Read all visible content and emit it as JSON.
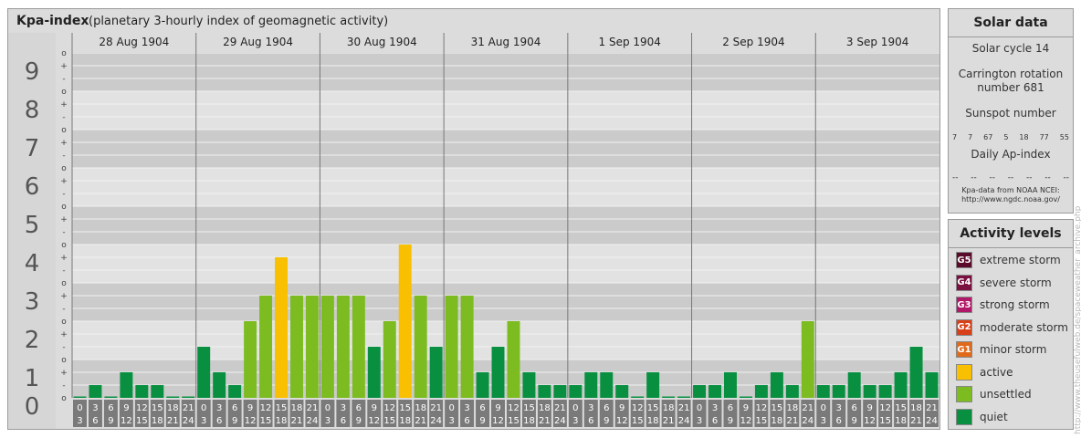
{
  "header": {
    "title": "Kpa-index",
    "subtitle": "(planetary 3-hourly index of geomagnetic activity)"
  },
  "solar": {
    "heading": "Solar data",
    "cycle": "Solar cycle 14",
    "carrington_line1": "Carrington rotation",
    "carrington_line2": "number 681",
    "sunspot_label": "Sunspot number",
    "sunspots": [
      "7",
      "7",
      "67",
      "5",
      "18",
      "77",
      "55"
    ],
    "ap_label": "Daily Ap-index",
    "ap_values": [
      "--",
      "--",
      "--",
      "--",
      "--",
      "--",
      "--"
    ],
    "source_line1": "Kpa-data from NOAA NCEI:",
    "source_line2": "http://www.ngdc.noaa.gov/"
  },
  "levels": {
    "heading": "Activity levels",
    "items": [
      {
        "code": "G5",
        "label": "extreme storm",
        "color": "#5a0a2a"
      },
      {
        "code": "G4",
        "label": "severe storm",
        "color": "#7a1040"
      },
      {
        "code": "G3",
        "label": "strong storm",
        "color": "#b01868"
      },
      {
        "code": "G2",
        "label": "moderate storm",
        "color": "#d8401a"
      },
      {
        "code": "G1",
        "label": "minor storm",
        "color": "#e06a1a"
      },
      {
        "code": "",
        "label": "active",
        "color": "#f8c000"
      },
      {
        "code": "",
        "label": "unsettled",
        "color": "#7cbc20"
      },
      {
        "code": "",
        "label": "quiet",
        "color": "#089040"
      }
    ]
  },
  "credit": "http://www.theusefulweb.de/spaceweather_archive.php",
  "chart_data": {
    "type": "bar",
    "ylim": [
      0,
      9
    ],
    "y_ticks": [
      "0",
      "1",
      "2",
      "3",
      "4",
      "5",
      "6",
      "7",
      "8",
      "9"
    ],
    "sub_ticks": [
      "o",
      "-",
      "+",
      "o",
      "-",
      "+",
      "o",
      "-",
      "+",
      "o",
      "-",
      "+",
      "o",
      "-",
      "+",
      "o",
      "-",
      "+",
      "o",
      "-",
      "+",
      "o",
      "-",
      "+",
      "o",
      "-",
      "+",
      "o"
    ],
    "days": [
      "28 Aug 1904",
      "29 Aug 1904",
      "30 Aug 1904",
      "31 Aug 1904",
      "1 Sep 1904",
      "2 Sep 1904",
      "3 Sep 1904"
    ],
    "interval_labels": [
      [
        "0",
        "3"
      ],
      [
        "3",
        "6"
      ],
      [
        "6",
        "9"
      ],
      [
        "9",
        "12"
      ],
      [
        "12",
        "15"
      ],
      [
        "15",
        "18"
      ],
      [
        "18",
        "21"
      ],
      [
        "21",
        "24"
      ]
    ],
    "values": [
      0,
      0.333,
      0,
      0.667,
      0.333,
      0.333,
      0,
      0,
      1.333,
      0.667,
      0.333,
      2,
      2.667,
      3.667,
      2.667,
      2.667,
      2.667,
      2.667,
      2.667,
      1.333,
      2,
      4,
      2.667,
      1.333,
      2.667,
      2.667,
      0.667,
      1.333,
      2,
      0.667,
      0.333,
      0.333,
      0.333,
      0.667,
      0.667,
      0.333,
      0,
      0.667,
      0,
      0,
      0.333,
      0.333,
      0.667,
      0,
      0.333,
      0.667,
      0.333,
      2,
      0.333,
      0.333,
      0.667,
      0.333,
      0.333,
      0.667,
      1.333,
      0.667
    ],
    "colors": {
      "quiet": "#089040",
      "unsettled": "#7cbc20",
      "active": "#f8c000"
    }
  }
}
